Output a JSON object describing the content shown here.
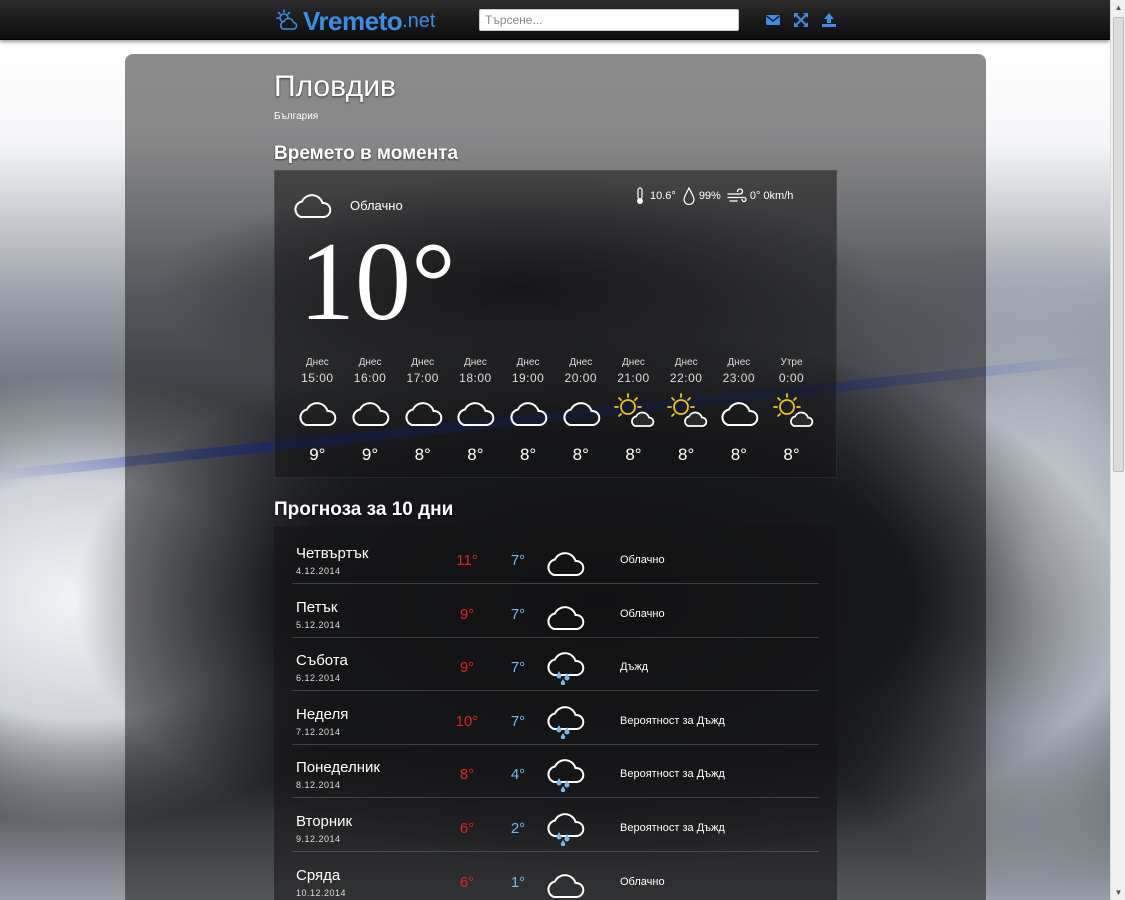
{
  "header": {
    "logo_main": "Vremeto",
    "logo_tld": ".net",
    "search_placeholder": "Търсене...",
    "icons": [
      "envelope-icon",
      "expand-icon",
      "upload-icon"
    ],
    "accent_color": "#3a8ee6"
  },
  "location": {
    "city": "Пловдив",
    "country": "България"
  },
  "current": {
    "section_title": "Времето в момента",
    "condition": "Облачно",
    "condition_icon": "cloud-icon",
    "temperature": "10°",
    "feels_like": "10.6°",
    "humidity": "99%",
    "wind": "0° 0km/h"
  },
  "hourly": [
    {
      "day": "Днес",
      "time": "15:00",
      "icon": "cloud",
      "temp": "9°"
    },
    {
      "day": "Днес",
      "time": "16:00",
      "icon": "cloud",
      "temp": "9°"
    },
    {
      "day": "Днес",
      "time": "17:00",
      "icon": "cloud",
      "temp": "8°"
    },
    {
      "day": "Днес",
      "time": "18:00",
      "icon": "cloud",
      "temp": "8°"
    },
    {
      "day": "Днес",
      "time": "19:00",
      "icon": "cloud",
      "temp": "8°"
    },
    {
      "day": "Днес",
      "time": "20:00",
      "icon": "cloud",
      "temp": "8°"
    },
    {
      "day": "Днес",
      "time": "21:00",
      "icon": "sun-cloud",
      "temp": "8°"
    },
    {
      "day": "Днес",
      "time": "22:00",
      "icon": "sun-cloud",
      "temp": "8°"
    },
    {
      "day": "Днес",
      "time": "23:00",
      "icon": "cloud",
      "temp": "8°"
    },
    {
      "day": "Утре",
      "time": "0:00",
      "icon": "sun-cloud",
      "temp": "8°"
    }
  ],
  "forecast": {
    "section_title": "Прогноза за 10 дни",
    "days": [
      {
        "day": "Четвъртък",
        "date": "4.12.2014",
        "high": "11°",
        "low": "7°",
        "icon": "cloud",
        "desc": "Облачно"
      },
      {
        "day": "Петък",
        "date": "5.12.2014",
        "high": "9°",
        "low": "7°",
        "icon": "cloud",
        "desc": "Облачно"
      },
      {
        "day": "Събота",
        "date": "6.12.2014",
        "high": "9°",
        "low": "7°",
        "icon": "rain",
        "desc": "Дъжд"
      },
      {
        "day": "Неделя",
        "date": "7.12.2014",
        "high": "10°",
        "low": "7°",
        "icon": "rain",
        "desc": "Вероятност за Дъжд"
      },
      {
        "day": "Понеделник",
        "date": "8.12.2014",
        "high": "8°",
        "low": "4°",
        "icon": "rain",
        "desc": "Вероятност за Дъжд"
      },
      {
        "day": "Вторник",
        "date": "9.12.2014",
        "high": "6°",
        "low": "2°",
        "icon": "rain",
        "desc": "Вероятност за Дъжд"
      },
      {
        "day": "Сряда",
        "date": "10.12.2014",
        "high": "6°",
        "low": "1°",
        "icon": "cloud",
        "desc": "Облачно"
      }
    ]
  },
  "colors": {
    "high_temp": "#e52020",
    "low_temp": "#79b8f0"
  }
}
